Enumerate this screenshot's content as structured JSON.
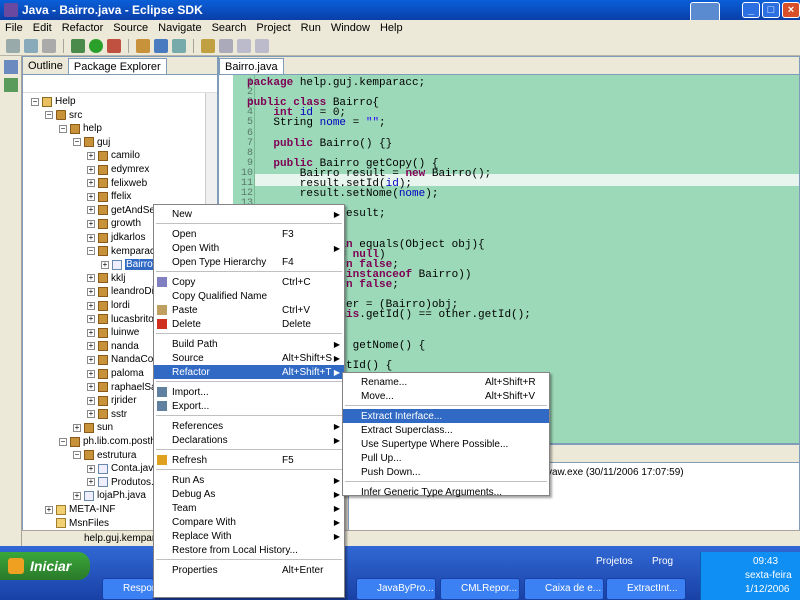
{
  "window": {
    "title": "Java - Bairro.java - Eclipse SDK"
  },
  "menubar": [
    "File",
    "Edit",
    "Refactor",
    "Source",
    "Navigate",
    "Search",
    "Project",
    "Run",
    "Window",
    "Help"
  ],
  "explorer": {
    "tabs": [
      "Outline",
      "Package Explorer"
    ],
    "tree": [
      {
        "label": "Help",
        "level": 0,
        "exp": "−",
        "icon": "prj"
      },
      {
        "label": "src",
        "level": 1,
        "exp": "−",
        "icon": "src"
      },
      {
        "label": "help",
        "level": 2,
        "exp": "−",
        "icon": "pkg"
      },
      {
        "label": "guj",
        "level": 3,
        "exp": "−",
        "icon": "pkg"
      },
      {
        "label": "camilo",
        "level": 4,
        "exp": "+",
        "icon": "pkg"
      },
      {
        "label": "edymrex",
        "level": 4,
        "exp": "+",
        "icon": "pkg"
      },
      {
        "label": "felixweb",
        "level": 4,
        "exp": "+",
        "icon": "pkg"
      },
      {
        "label": "ffelix",
        "level": 4,
        "exp": "+",
        "icon": "pkg"
      },
      {
        "label": "getAndSe",
        "level": 4,
        "exp": "+",
        "icon": "pkg"
      },
      {
        "label": "growth",
        "level": 4,
        "exp": "+",
        "icon": "pkg"
      },
      {
        "label": "jdkarlos",
        "level": 4,
        "exp": "+",
        "icon": "pkg"
      },
      {
        "label": "kemparac",
        "level": 4,
        "exp": "−",
        "icon": "pkg"
      },
      {
        "label": "Bairro",
        "level": 5,
        "exp": "+",
        "icon": "jfile",
        "sel": true
      },
      {
        "label": "kklj",
        "level": 4,
        "exp": "+",
        "icon": "pkg"
      },
      {
        "label": "leandroDi",
        "level": 4,
        "exp": "+",
        "icon": "pkg"
      },
      {
        "label": "lordi",
        "level": 4,
        "exp": "+",
        "icon": "pkg"
      },
      {
        "label": "lucasbrito",
        "level": 4,
        "exp": "+",
        "icon": "pkg"
      },
      {
        "label": "luinwe",
        "level": 4,
        "exp": "+",
        "icon": "pkg"
      },
      {
        "label": "nanda",
        "level": 4,
        "exp": "+",
        "icon": "pkg"
      },
      {
        "label": "NandaCor",
        "level": 4,
        "exp": "+",
        "icon": "pkg"
      },
      {
        "label": "paloma",
        "level": 4,
        "exp": "+",
        "icon": "pkg"
      },
      {
        "label": "raphaelSa",
        "level": 4,
        "exp": "+",
        "icon": "pkg"
      },
      {
        "label": "rjrider",
        "level": 4,
        "exp": "+",
        "icon": "pkg"
      },
      {
        "label": "sstr",
        "level": 4,
        "exp": "+",
        "icon": "pkg"
      },
      {
        "label": "sun",
        "level": 3,
        "exp": "+",
        "icon": "pkg"
      },
      {
        "label": "ph.lib.com.posthal",
        "level": 2,
        "exp": "−",
        "icon": "pkg"
      },
      {
        "label": "estrutura",
        "level": 3,
        "exp": "−",
        "icon": "pkg"
      },
      {
        "label": "Conta.java",
        "level": 4,
        "exp": "+",
        "icon": "jfile"
      },
      {
        "label": "Produtos.j",
        "level": 4,
        "exp": "+",
        "icon": "jfile"
      },
      {
        "label": "lojaPh.java",
        "level": 3,
        "exp": "+",
        "icon": "jfile"
      },
      {
        "label": "META-INF",
        "level": 1,
        "exp": "+",
        "icon": "fold"
      },
      {
        "label": "MsnFiles",
        "level": 1,
        "exp": "",
        "icon": "fold"
      }
    ]
  },
  "editor": {
    "tab": "Bairro.java",
    "lines": [
      {
        "n": "1",
        "html": "<span class='kw'>package</span> help.guj.kemparacc;"
      },
      {
        "n": "2",
        "html": ""
      },
      {
        "n": "3",
        "html": "<span class='kw'>public class</span> Bairro{"
      },
      {
        "n": "4",
        "html": "    <span class='kw'>int</span> <span class='fld'>id</span> = 0;"
      },
      {
        "n": "5",
        "html": "    String <span class='fld'>nome</span> = <span class='str'>\"\"</span>;"
      },
      {
        "n": "6",
        "html": ""
      },
      {
        "n": "7",
        "html": "    <span class='kw'>public</span> Bairro() {}"
      },
      {
        "n": "8",
        "html": ""
      },
      {
        "n": "9",
        "html": "    <span class='kw'>public</span> Bairro getCopy() {"
      },
      {
        "n": "10",
        "html": "        Bairro result = <span class='kw'>new</span> Bairro();"
      },
      {
        "n": "11",
        "html": "        result.setId(<span class='fld'>id</span>);"
      },
      {
        "n": "12",
        "html": "        result.setNome(<span class='fld'>nome</span>);"
      },
      {
        "n": "13",
        "html": ""
      },
      {
        "n": "",
        "html": "              result;"
      },
      {
        "n": "",
        "html": ""
      },
      {
        "n": "",
        "html": ""
      },
      {
        "n": "",
        "html": "            <span class='kw'>lean</span> equals(Object obj){"
      },
      {
        "n": "",
        "html": "             == <span class='kw'>null</span>)"
      },
      {
        "n": "",
        "html": "             <span class='kw'>urn false</span>;"
      },
      {
        "n": "",
        "html": "            bj <span class='kw'>instanceof</span> Bairro))"
      },
      {
        "n": "",
        "html": "             <span class='kw'>urn false</span>;"
      },
      {
        "n": "",
        "html": ""
      },
      {
        "n": "",
        "html": "            other = (Bairro)obj;"
      },
      {
        "n": "",
        "html": "             <span class='kw'>this</span>.getId() == other.getId();"
      },
      {
        "n": "",
        "html": ""
      },
      {
        "n": "",
        "html": ""
      },
      {
        "n": "",
        "html": "            ing getNome() {"
      },
      {
        "n": "",
        "html": ""
      },
      {
        "n": "",
        "html": "             getId() {"
      }
    ]
  },
  "console": {
    "text": "vaw.exe (30/11/2006 17:07:59)"
  },
  "statusbar": {
    "text": "help.guj.kemparacc"
  },
  "context_menu": [
    {
      "label": "New",
      "acc": "",
      "arrow": true
    },
    {
      "sep": true
    },
    {
      "label": "Open",
      "acc": "F3"
    },
    {
      "label": "Open With",
      "acc": "",
      "arrow": true
    },
    {
      "label": "Open Type Hierarchy",
      "acc": "F4"
    },
    {
      "sep": true
    },
    {
      "label": "Copy",
      "acc": "Ctrl+C",
      "icon": "#8080c0"
    },
    {
      "label": "Copy Qualified Name",
      "acc": ""
    },
    {
      "label": "Paste",
      "acc": "Ctrl+V",
      "icon": "#c0a060"
    },
    {
      "label": "Delete",
      "acc": "Delete",
      "icon": "#d03020"
    },
    {
      "sep": true
    },
    {
      "label": "Build Path",
      "acc": "",
      "arrow": true
    },
    {
      "label": "Source",
      "acc": "Alt+Shift+S",
      "arrow": true
    },
    {
      "label": "Refactor",
      "acc": "Alt+Shift+T",
      "arrow": true,
      "sel": true
    },
    {
      "sep": true
    },
    {
      "label": "Import...",
      "acc": "",
      "icon": "#6080a0"
    },
    {
      "label": "Export...",
      "acc": "",
      "icon": "#6080a0"
    },
    {
      "sep": true
    },
    {
      "label": "References",
      "acc": "",
      "arrow": true
    },
    {
      "label": "Declarations",
      "acc": "",
      "arrow": true
    },
    {
      "sep": true
    },
    {
      "label": "Refresh",
      "acc": "F5",
      "icon": "#e0a020"
    },
    {
      "sep": true
    },
    {
      "label": "Run As",
      "acc": "",
      "arrow": true
    },
    {
      "label": "Debug As",
      "acc": "",
      "arrow": true
    },
    {
      "label": "Team",
      "acc": "",
      "arrow": true
    },
    {
      "label": "Compare With",
      "acc": "",
      "arrow": true
    },
    {
      "label": "Replace With",
      "acc": "",
      "arrow": true
    },
    {
      "label": "Restore from Local History...",
      "acc": ""
    },
    {
      "sep": true
    },
    {
      "label": "Properties",
      "acc": "Alt+Enter"
    }
  ],
  "submenu": [
    {
      "label": "Rename...",
      "acc": "Alt+Shift+R"
    },
    {
      "label": "Move...",
      "acc": "Alt+Shift+V"
    },
    {
      "sep": true
    },
    {
      "label": "Extract Interface...",
      "acc": "",
      "sel": true
    },
    {
      "label": "Extract Superclass...",
      "acc": ""
    },
    {
      "label": "Use Supertype Where Possible...",
      "acc": ""
    },
    {
      "label": "Pull Up...",
      "acc": ""
    },
    {
      "label": "Push Down...",
      "acc": ""
    },
    {
      "sep": true
    },
    {
      "label": "Infer Generic Type Arguments...",
      "acc": ""
    }
  ],
  "taskbar": {
    "start": "Iniciar",
    "tasks": [
      "Respon",
      "JavaByPro...",
      "CMLRepor...",
      "Caixa de e...",
      "ExtractInt..."
    ],
    "quick": [
      "Projetos",
      "Prog"
    ],
    "clock": {
      "time": "09:43",
      "day": "sexta-feira",
      "date": "1/12/2006"
    }
  },
  "colors": {
    "titlebar": "#0a3ea8",
    "editor_bg": "#9bd9b8",
    "menu_sel": "#316ac5",
    "taskbar": "#245edb"
  }
}
